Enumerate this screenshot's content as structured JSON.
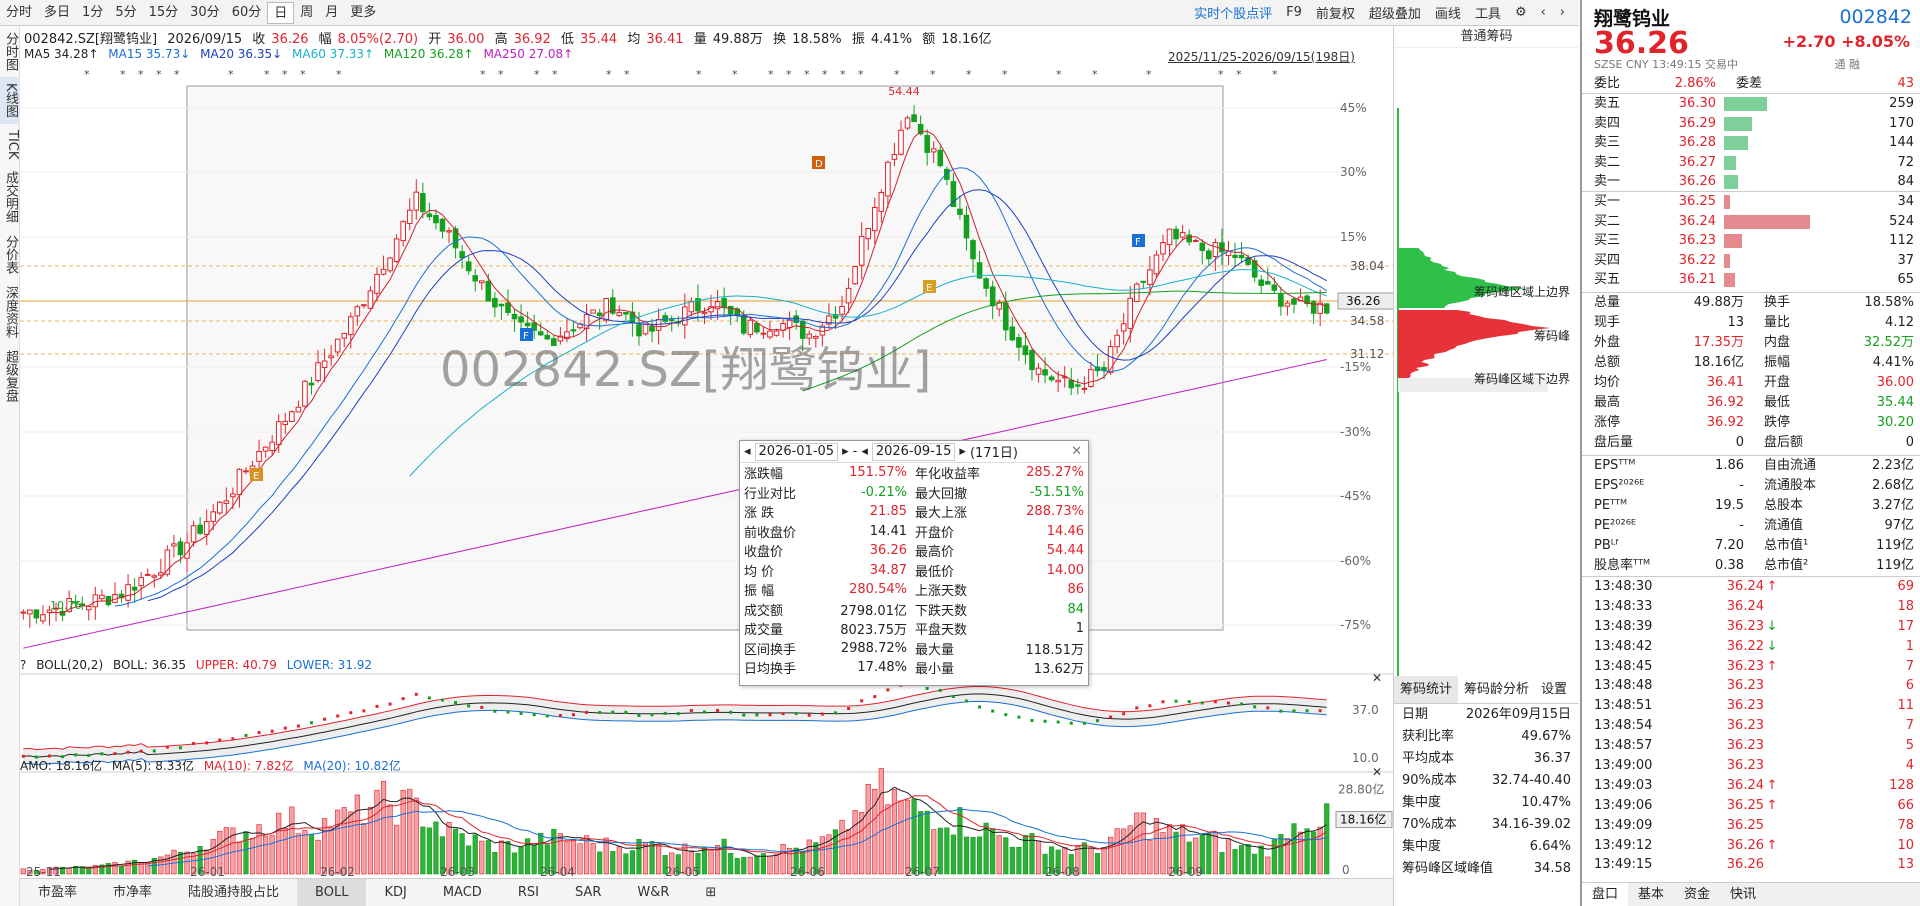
{
  "toolbar": {
    "periods": [
      "分时",
      "多日",
      "1分",
      "5分",
      "15分",
      "30分",
      "60分",
      "日",
      "周",
      "月",
      "更多"
    ],
    "active": "日",
    "right_items": [
      "实时个股点评",
      "F9",
      "前复权",
      "超级叠加",
      "画线",
      "工具"
    ]
  },
  "leftnav": [
    "分时图",
    "K线图",
    "TICK",
    "成交明细",
    "分价表",
    "深度资料",
    "超级复盘"
  ],
  "leftnav_active": "K线图",
  "kinfo": {
    "code_name": "002842.SZ[翔鹭钨业]",
    "date": "2026/09/15",
    "close_label": "收",
    "close": "36.26",
    "amp_label": "幅",
    "amp": "8.05%(2.70)",
    "open_label": "开",
    "open": "36.00",
    "high_label": "高",
    "high": "36.92",
    "low_label": "低",
    "low": "35.44",
    "avg_label": "均",
    "avg": "36.41",
    "vol_label": "量",
    "vol": "49.88万",
    "turn_label": "换",
    "turn": "18.58%",
    "zf_label": "振",
    "zf": "4.41%",
    "amt_label": "额",
    "amt": "18.16亿"
  },
  "ma": {
    "ma5": "MA5 34.28↑",
    "ma15": "MA15 35.73↓",
    "ma20": "MA20 36.35↓",
    "ma60": "MA60 37.33↑",
    "ma120": "MA120 36.28↑",
    "ma250": "MA250 27.08↑"
  },
  "range_label": "2025/11/25-2026/09/15(198日)",
  "watermark": "002842.SZ[翔鹭钨业]",
  "chip": {
    "header": "普通筹码",
    "upper_label": "筹码峰区域上边界",
    "peak_label": "筹码峰",
    "lower_label": "筹码峰区域下边界",
    "upper_val": "38.04",
    "cur_val": "36.26",
    "peak_val": "34.58",
    "lower_val": "31.12"
  },
  "axis_pct": [
    "45%",
    "30%",
    "15%",
    "-15%",
    "-30%",
    "-45%",
    "-60%",
    "-75%"
  ],
  "main_marks": {
    "high": "54.44",
    "low": "10.76"
  },
  "markers": [
    "E",
    "F",
    "D",
    "E",
    "F"
  ],
  "popup": {
    "date_from": "2026-01-05",
    "date_to": "2026-09-15",
    "days": "(171日)",
    "rows": [
      {
        "k1": "涨跌幅",
        "v1": "151.57%",
        "c1": "red",
        "k2": "年化收益率",
        "v2": "285.27%",
        "c2": "red"
      },
      {
        "k1": "行业对比",
        "v1": "-0.21%",
        "c1": "green",
        "k2": "最大回撤",
        "v2": "-51.51%",
        "c2": "green"
      },
      {
        "k1": "涨 跌",
        "v1": "21.85",
        "c1": "red",
        "k2": "最大上涨",
        "v2": "288.73%",
        "c2": "red"
      },
      {
        "k1": "前收盘价",
        "v1": "14.41",
        "c1": "",
        "k2": "开盘价",
        "v2": "14.46",
        "c2": "red"
      },
      {
        "k1": "收盘价",
        "v1": "36.26",
        "c1": "red",
        "k2": "最高价",
        "v2": "54.44",
        "c2": "red"
      },
      {
        "k1": "均 价",
        "v1": "34.87",
        "c1": "red",
        "k2": "最低价",
        "v2": "14.00",
        "c2": "red"
      },
      {
        "k1": "振 幅",
        "v1": "280.54%",
        "c1": "red",
        "k2": "上涨天数",
        "v2": "86",
        "c2": "red"
      },
      {
        "k1": "成交额",
        "v1": "2798.01亿",
        "c1": "",
        "k2": "下跌天数",
        "v2": "84",
        "c2": "green"
      },
      {
        "k1": "成交量",
        "v1": "8023.75万",
        "c1": "",
        "k2": "平盘天数",
        "v2": "1",
        "c2": ""
      },
      {
        "k1": "区间换手",
        "v1": "2988.72%",
        "c1": "",
        "k2": "最大量",
        "v2": "118.51万",
        "c2": ""
      },
      {
        "k1": "日均换手",
        "v1": "17.48%",
        "c1": "",
        "k2": "最小量",
        "v2": "13.62万",
        "c2": ""
      }
    ]
  },
  "boll": {
    "name": "BOLL(20,2)",
    "mid": "BOLL: 36.35",
    "upper": "UPPER: 40.79",
    "lower": "LOWER: 31.92",
    "axis": [
      "37.0",
      "10.0"
    ]
  },
  "amo": {
    "name": "AMO: 18.16亿",
    "ma5": "MA(5): 8.33亿",
    "ma10": "MA(10): 7.82亿",
    "ma20": "MA(20): 10.82亿",
    "axis_top": "28.80亿",
    "axis_cur": "18.16亿",
    "axis_zero": "0"
  },
  "xaxis": [
    "25-11",
    "26-01",
    "26-02",
    "26-03",
    "26-04",
    "26-05",
    "26-06",
    "26-07",
    "26-08",
    "26-09"
  ],
  "bottom_tabs": [
    "市盈率",
    "市净率",
    "陆股通持股占比",
    "BOLL",
    "KDJ",
    "MACD",
    "RSI",
    "SAR",
    "W&R",
    "⊞"
  ],
  "bottom_active": "BOLL",
  "chip_stats": {
    "tabs": [
      "筹码统计",
      "筹码龄分析",
      "设置"
    ],
    "rows": [
      [
        "日期",
        "2026年09月15日"
      ],
      [
        "获利比率",
        "49.67%"
      ],
      [
        "平均成本",
        "36.37"
      ],
      [
        "90%成本",
        "32.74-40.40"
      ],
      [
        "集中度",
        "10.47%"
      ],
      [
        "70%成本",
        "34.16-39.02"
      ],
      [
        "集中度",
        "6.64%"
      ],
      [
        "筹码峰区域峰值",
        "34.58"
      ]
    ]
  },
  "quote": {
    "name": "翔鹭钨业",
    "code": "002842",
    "price": "36.26",
    "change": "+2.70",
    "change_pct": "+8.05%",
    "sub": "SZSE  CNY  13:49:15  交易中",
    "flags": "通  融",
    "wb_label": "委比",
    "wb": "2.86%",
    "wc_label": "委差",
    "wc": "43",
    "asks": [
      {
        "l": "卖五",
        "p": "36.30",
        "v": "259"
      },
      {
        "l": "卖四",
        "p": "36.29",
        "v": "170"
      },
      {
        "l": "卖三",
        "p": "36.28",
        "v": "144"
      },
      {
        "l": "卖二",
        "p": "36.27",
        "v": "72"
      },
      {
        "l": "卖一",
        "p": "36.26",
        "v": "84"
      }
    ],
    "bids": [
      {
        "l": "买一",
        "p": "36.25",
        "v": "34"
      },
      {
        "l": "买二",
        "p": "36.24",
        "v": "524"
      },
      {
        "l": "买三",
        "p": "36.23",
        "v": "112"
      },
      {
        "l": "买四",
        "p": "36.22",
        "v": "37"
      },
      {
        "l": "买五",
        "p": "36.21",
        "v": "65"
      }
    ],
    "stats": [
      [
        "总量",
        "49.88万",
        "换手",
        "18.58%"
      ],
      [
        "现手",
        "13",
        "量比",
        "4.12"
      ],
      [
        "外盘",
        "17.35万",
        "内盘",
        "32.52万"
      ],
      [
        "总额",
        "18.16亿",
        "振幅",
        "4.41%"
      ],
      [
        "均价",
        "36.41",
        "开盘",
        "36.00"
      ],
      [
        "最高",
        "36.92",
        "最低",
        "35.44"
      ],
      [
        "涨停",
        "36.92",
        "跌停",
        "30.20"
      ],
      [
        "盘后量",
        "0",
        "盘后额",
        "0"
      ]
    ],
    "fund": [
      [
        "EPSᵀᵀᴹ",
        "1.86",
        "自由流通",
        "2.23亿"
      ],
      [
        "EPS²⁰²⁶ᴱ",
        "-",
        "流通股本",
        "2.68亿"
      ],
      [
        "PEᵀᵀᴹ",
        "19.5",
        "总股本",
        "3.27亿"
      ],
      [
        "PE²⁰²⁶ᴱ",
        "-",
        "流通值",
        "97亿"
      ],
      [
        "PBᴸᶠ",
        "7.20",
        "总市值¹",
        "119亿"
      ],
      [
        "股息率ᵀᵀᴹ",
        "0.38",
        "总市值²",
        "119亿"
      ]
    ],
    "ticks": [
      [
        "13:48:30",
        "36.24",
        "↑",
        "69"
      ],
      [
        "13:48:33",
        "36.24",
        "",
        "18"
      ],
      [
        "13:48:39",
        "36.23",
        "↓",
        "17"
      ],
      [
        "13:48:42",
        "36.22",
        "↓",
        "1"
      ],
      [
        "13:48:45",
        "36.23",
        "↑",
        "7"
      ],
      [
        "13:48:48",
        "36.23",
        "",
        "6"
      ],
      [
        "13:48:51",
        "36.23",
        "",
        "11"
      ],
      [
        "13:48:54",
        "36.23",
        "",
        "7"
      ],
      [
        "13:48:57",
        "36.23",
        "",
        "5"
      ],
      [
        "13:49:00",
        "36.23",
        "",
        "4"
      ],
      [
        "13:49:03",
        "36.24",
        "↑",
        "128"
      ],
      [
        "13:49:06",
        "36.25",
        "↑",
        "66"
      ],
      [
        "13:49:09",
        "36.25",
        "",
        "78"
      ],
      [
        "13:49:12",
        "36.26",
        "↑",
        "10"
      ],
      [
        "13:49:15",
        "36.26",
        "",
        "13"
      ]
    ],
    "tabs": [
      "盘口",
      "基本",
      "资金",
      "快讯"
    ]
  },
  "chart_data": {
    "type": "candlestick",
    "symbol": "002842.SZ[翔鹭钨业]",
    "period": "日",
    "range": "2025/11/25-2026/09/15",
    "x_ticks": [
      "25-11",
      "26-01",
      "26-02",
      "26-03",
      "26-04",
      "26-05",
      "26-06",
      "26-07",
      "26-08",
      "26-09"
    ],
    "price_approx": [
      11.0,
      11.3,
      11.8,
      12.6,
      14.5,
      16.8,
      19.8,
      23.5,
      27.0,
      31.0,
      35.0,
      40.0,
      45.0,
      42.0,
      38.0,
      34.5,
      33.5,
      35.0,
      36.5,
      34.0,
      35.5,
      36.8,
      34.5,
      35.0,
      34.0,
      36.5,
      45.0,
      52.5,
      48.0,
      40.0,
      35.0,
      31.0,
      29.5,
      31.0,
      37.5,
      42.0,
      41.0,
      40.5,
      37.5,
      36.26
    ],
    "high": 54.44,
    "low": 10.76,
    "last": 36.26,
    "ylim": [
      10,
      56
    ],
    "amount_approx": [
      1.5,
      2.0,
      2.2,
      3.5,
      5.0,
      8.0,
      12.0,
      15.0,
      18.0,
      16.0,
      20.0,
      24.0,
      22.0,
      14.0,
      10.0,
      9.0,
      12.0,
      11.0,
      9.0,
      10.0,
      8.0,
      10.0,
      7.0,
      8.0,
      9.0,
      14.0,
      28.8,
      22.0,
      20.0,
      16.0,
      12.0,
      10.0,
      8.0,
      9.0,
      18.0,
      14.0,
      12.0,
      9.0,
      8.0,
      18.16
    ]
  }
}
